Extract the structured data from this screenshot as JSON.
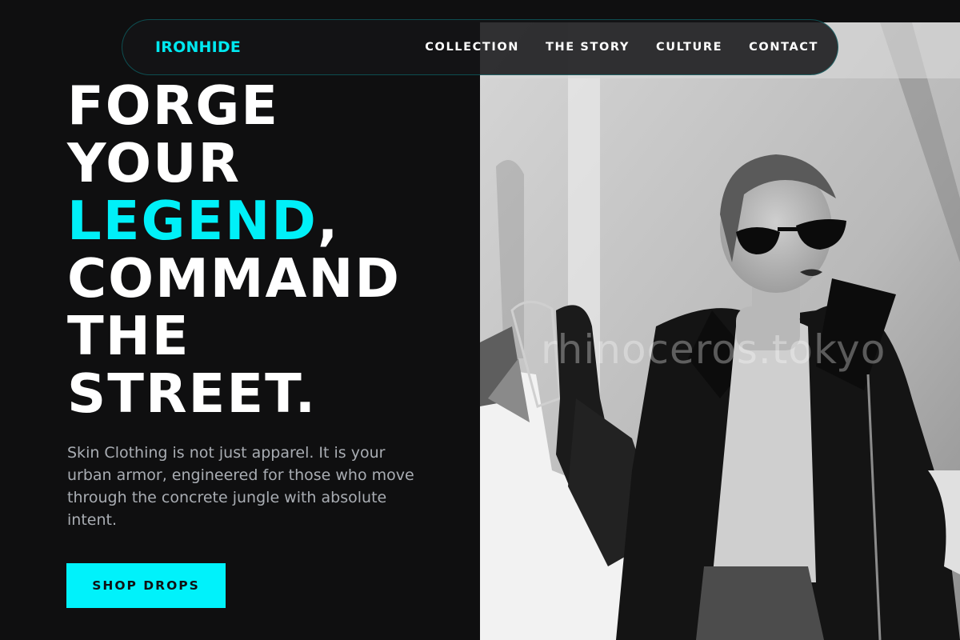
{
  "brand": {
    "name": "IRONHIDE"
  },
  "nav": {
    "links": [
      {
        "label": "COLLECTION"
      },
      {
        "label": "THE STORY"
      },
      {
        "label": "CULTURE"
      },
      {
        "label": "CONTACT"
      }
    ]
  },
  "hero": {
    "headline": {
      "line1": "FORGE",
      "line2": "YOUR",
      "line3_accent": "LEGEND",
      "line3_punct": ",",
      "line4": "COMMAND",
      "line5": "THE",
      "line6": "STREET."
    },
    "description": "Skin Clothing is not just apparel. It is your urban armor, engineered for those who move through the concrete jungle with absolute intent.",
    "cta_label": "SHOP DROPS"
  },
  "image": {
    "watermark": "rhinoceros.tokyo"
  },
  "colors": {
    "accent": "#00f0f8",
    "background": "#0f0f10",
    "body_text": "#a9adb3"
  }
}
